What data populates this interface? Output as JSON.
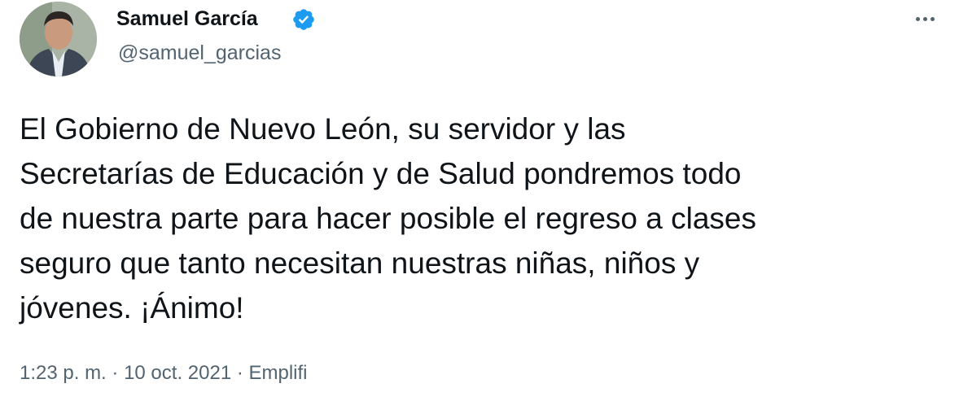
{
  "user": {
    "display_name": "Samuel García",
    "handle": "@samuel_garcias",
    "verified_icon": "verified-badge-icon",
    "verified_color": "#1d9bf0"
  },
  "tweet": {
    "text": "El Gobierno de Nuevo León, su servidor y las\nSecretarías de Educación y de Salud pondremos todo\nde nuestra parte para hacer posible el regreso a clases\nseguro que tanto necesitan nuestras niñas, niños y\njóvenes. ¡Ánimo!",
    "time": "1:23 p. m.",
    "separator": " · ",
    "date": "10 oct. 2021",
    "source": "Emplifi"
  },
  "actions": {
    "more_icon": "more-options-icon"
  },
  "colors": {
    "text": "#0f1419",
    "secondary": "#536471",
    "background": "#ffffff"
  }
}
